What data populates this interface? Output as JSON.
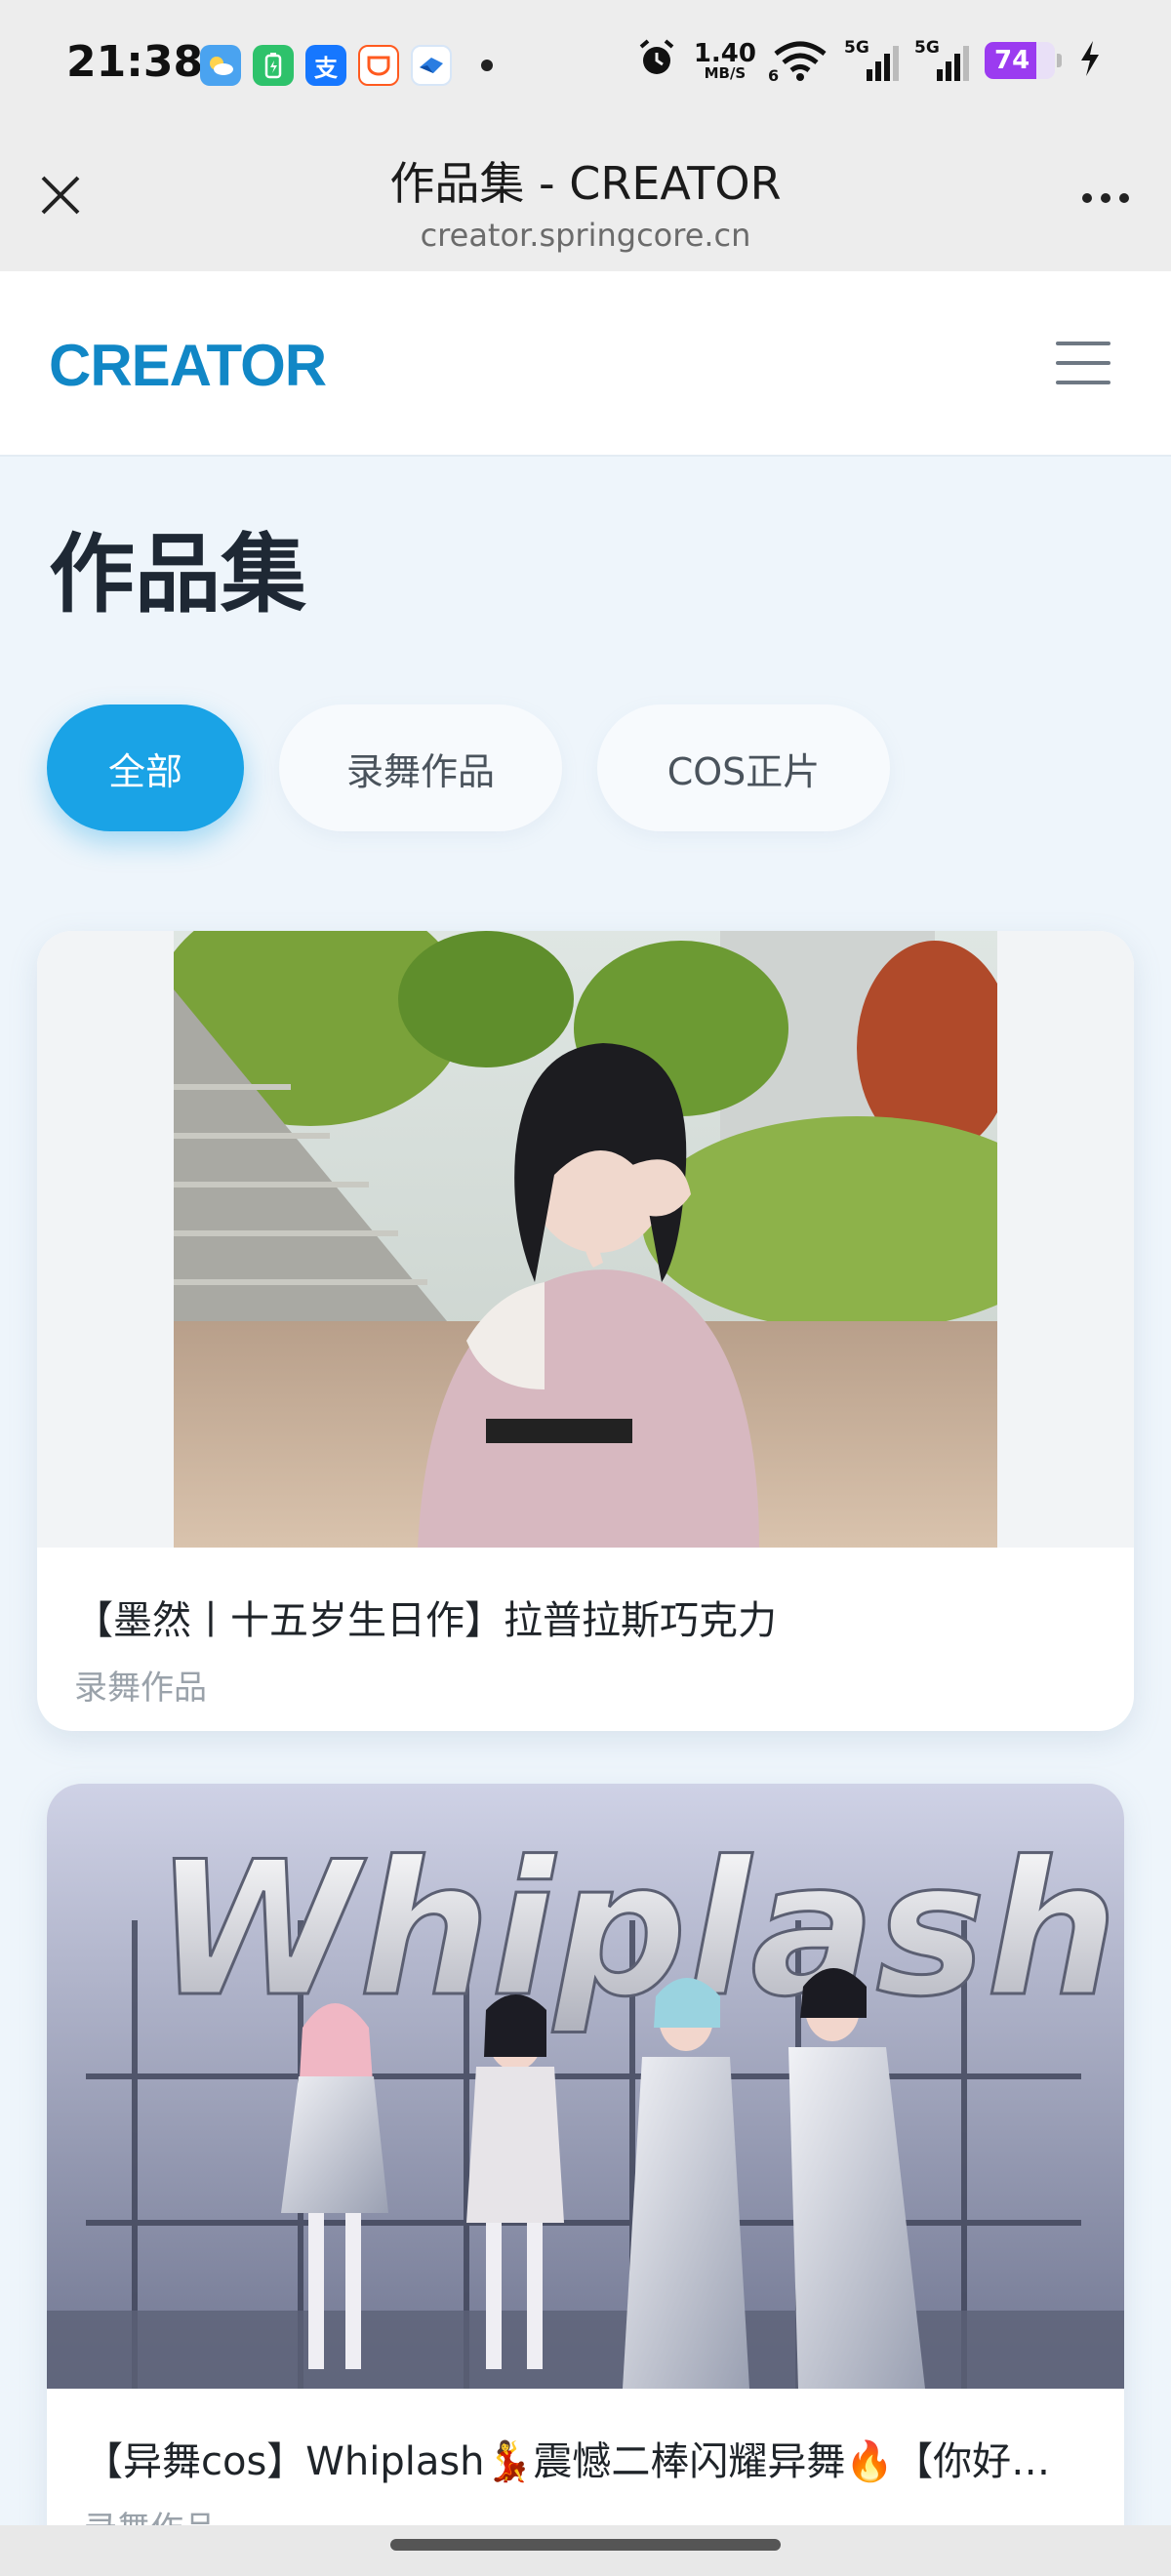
{
  "status_bar": {
    "time": "21:38",
    "network_speed_value": "1.40",
    "network_speed_unit": "MB/S",
    "wifi_sub": "6",
    "sim1_label": "5G",
    "sim2_label": "5G",
    "battery": "74",
    "battery_level": 0.74,
    "accent_battery": "#9b3bf0",
    "app_icons": [
      {
        "name": "weather-app-icon",
        "color": "#4aa3f0"
      },
      {
        "name": "battery-app-icon",
        "color": "#2ec26b"
      },
      {
        "name": "alipay-app-icon",
        "color": "#1677ff",
        "glyph": "支"
      },
      {
        "name": "taobao-app-icon",
        "color": "#ff5a1f"
      },
      {
        "name": "bird-app-icon",
        "color": "#2a7de1"
      }
    ]
  },
  "webview": {
    "title": "作品集 - CREATOR",
    "url": "creator.springcore.cn"
  },
  "site": {
    "logo": "CREATOR",
    "brand_color": "#1187c6"
  },
  "main": {
    "page_title": "作品集",
    "filters": [
      {
        "label": "全部",
        "active": true
      },
      {
        "label": "录舞作品",
        "active": false
      },
      {
        "label": "COS正片",
        "active": false
      }
    ],
    "accent": "#1aa3e6",
    "cards": [
      {
        "title": "【墨然丨十五岁生日作】拉普拉斯巧克力",
        "category": "录舞作品"
      },
      {
        "title": "【异舞cos】Whiplash💃震憾二棒闪耀异舞🔥【你好…",
        "category": "录舞作品",
        "image_text": "Whiplash"
      }
    ]
  }
}
